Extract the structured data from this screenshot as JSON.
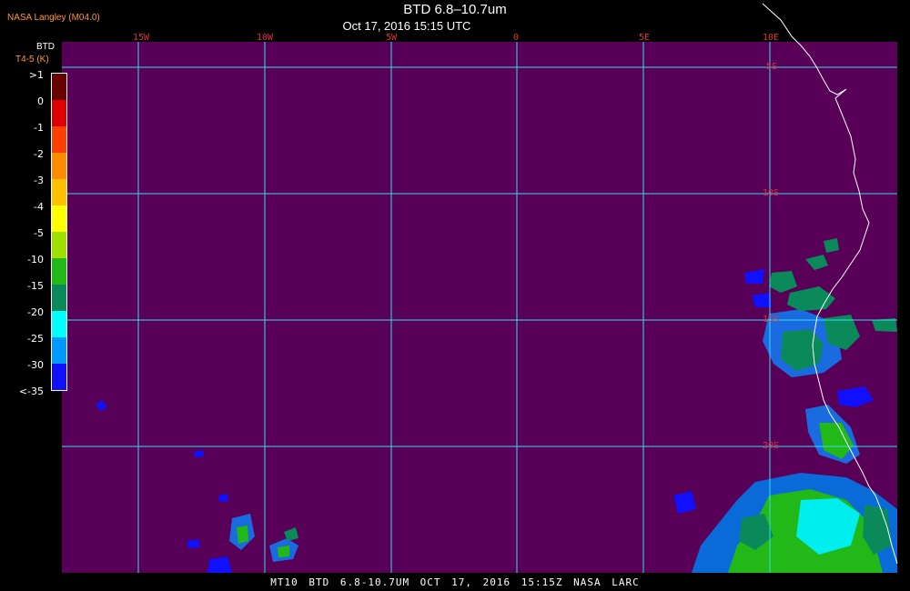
{
  "header": {
    "credit": "NASA Langley (M04.0)",
    "title": "BTD 6.8–10.7um",
    "datetime": "Oct 17, 2016 15:15 UTC"
  },
  "legend": {
    "title": "BTD",
    "unit": "T4-5 (K)",
    "labels": [
      ">1",
      "0",
      "-1",
      "-2",
      "-3",
      "-4",
      "-5",
      "-10",
      "-15",
      "-20",
      "-25",
      "-30",
      "<-35"
    ],
    "colors": [
      "#6a0000",
      "#dd0000",
      "#ff4000",
      "#ff8c00",
      "#ffc000",
      "#ffff00",
      "#9fe000",
      "#22b818",
      "#0a8a5a",
      "#00ffff",
      "#0099ff",
      "#1010ff",
      "#550055"
    ]
  },
  "map": {
    "background_color": "#580058",
    "grid_color": "#33ddee",
    "longitude_labels": [
      "15W",
      "10W",
      "5W",
      "0",
      "5E",
      "10E"
    ],
    "latitude_labels": [
      "5S",
      "10S",
      "15S",
      "20S"
    ]
  },
  "footer": {
    "text": "MT10  BTD 6.8-10.7UM  OCT 17, 2016 15:15Z  NASA LARC"
  }
}
